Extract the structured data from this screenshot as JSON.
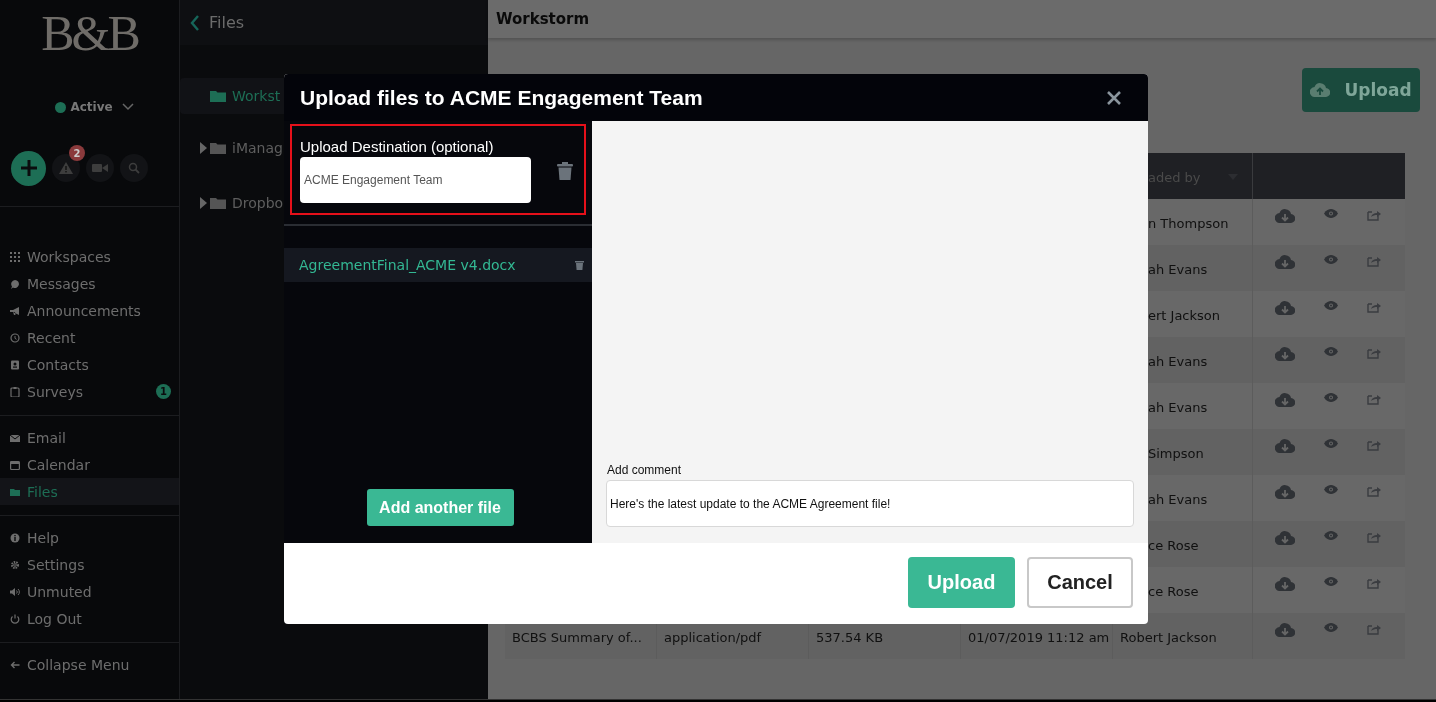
{
  "sidebar": {
    "logo": "B&B",
    "status": {
      "label": "Active",
      "color": "#1d6e55"
    },
    "alerts_badge": "2",
    "groups": [
      {
        "items": [
          {
            "label": "Workspaces",
            "selected": false
          },
          {
            "label": "Messages",
            "selected": false
          },
          {
            "label": "Announcements",
            "selected": false
          },
          {
            "label": "Recent",
            "selected": false
          },
          {
            "label": "Contacts",
            "selected": false
          },
          {
            "label": "Surveys",
            "selected": false,
            "badge": "1"
          }
        ]
      },
      {
        "items": [
          {
            "label": "Email",
            "selected": false
          },
          {
            "label": "Calendar",
            "selected": false
          },
          {
            "label": "Files",
            "selected": true
          }
        ]
      },
      {
        "items": [
          {
            "label": "Help",
            "selected": false
          },
          {
            "label": "Settings",
            "selected": false
          },
          {
            "label": "Unmuted",
            "selected": false
          },
          {
            "label": "Log Out",
            "selected": false
          }
        ]
      },
      {
        "items": [
          {
            "label": "Collapse Menu",
            "selected": false
          }
        ]
      }
    ]
  },
  "files_panel": {
    "title": "Files",
    "tree": [
      {
        "label": "Workst",
        "selected": true,
        "expandable": false
      },
      {
        "label": "iManag",
        "selected": false,
        "expandable": true
      },
      {
        "label": "Dropbo",
        "selected": false,
        "expandable": true
      }
    ]
  },
  "main": {
    "title": "Workstorm",
    "upload_button": "Upload",
    "table": {
      "columns": [
        "aded by"
      ],
      "rows": [
        {
          "uploaded_by": "n Thompson"
        },
        {
          "uploaded_by": "ah Evans"
        },
        {
          "uploaded_by": "ert Jackson"
        },
        {
          "uploaded_by": "ah Evans"
        },
        {
          "uploaded_by": "ah Evans"
        },
        {
          "uploaded_by": "Simpson"
        },
        {
          "uploaded_by": "ah Evans"
        },
        {
          "uploaded_by": "ce Rose"
        },
        {
          "uploaded_by": "ce Rose"
        },
        {
          "name": "BCBS Summary of...",
          "type": "application/pdf",
          "size": "537.54 KB",
          "date": "01/07/2019 11:12 am",
          "uploaded_by": "Robert Jackson"
        }
      ]
    }
  },
  "modal": {
    "title": "Upload files to ACME Engagement Team",
    "destination_label": "Upload Destination (optional)",
    "destination_value": "ACME Engagement Team",
    "files": [
      {
        "name": "AgreementFinal_ACME v4.docx"
      }
    ],
    "add_file_button": "Add another file",
    "comment_label": "Add comment",
    "comment_value": "Here's the latest update to the ACME Agreement file!",
    "buttons": [
      {
        "label": "Upload",
        "kind": "primary"
      },
      {
        "label": "Cancel",
        "kind": "secondary"
      }
    ]
  }
}
